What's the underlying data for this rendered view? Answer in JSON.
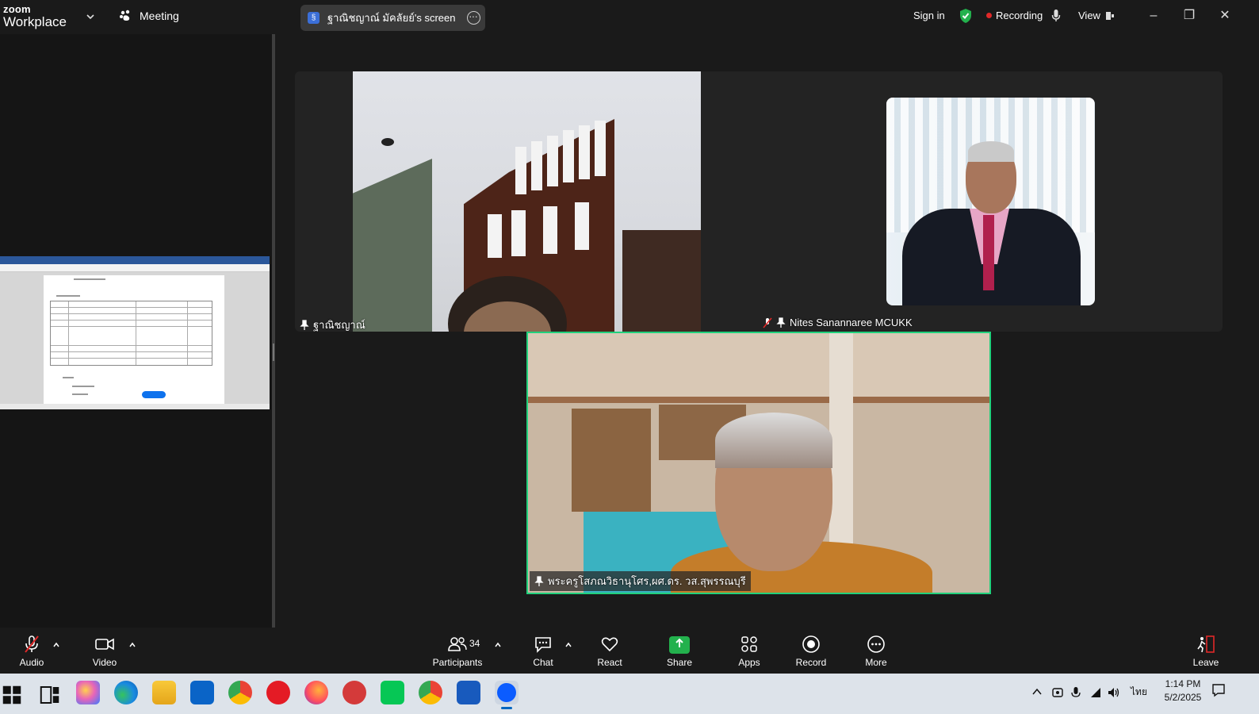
{
  "topbar": {
    "brand_small": "zoom",
    "brand_big": "Workplace",
    "meeting_label": "Meeting",
    "share_screen_label": "ฐาณิชญาณ์ มัคลัยย์'s screen",
    "share_icon_glyph": "§",
    "sign_in": "Sign in",
    "recording": "Recording",
    "view": "View",
    "colors": {
      "shield": "#23b14d",
      "recording_dot": "#e02828"
    }
  },
  "participants_tiles": [
    {
      "name": "ฐาณิชญาณ์"
    },
    {
      "name": "Nites Sanannaree MCUKK",
      "muted": true
    },
    {
      "name": "พระครูโสภณวิธานุโศร,ผศ.ดร. วส.สุพรรณบุรี",
      "active_speaker": true
    }
  ],
  "toolbar": {
    "audio": "Audio",
    "video": "Video",
    "participants": "Participants",
    "participants_count": "34",
    "chat": "Chat",
    "react": "React",
    "share": "Share",
    "apps": "Apps",
    "record": "Record",
    "more": "More",
    "leave": "Leave",
    "colors": {
      "share": "#23b14d",
      "leave": "#e02828",
      "speaker_border": "#21d17c"
    }
  },
  "taskbar": {
    "language": "ไทย",
    "time": "1:14 PM",
    "date": "5/2/2025",
    "apps": [
      "windows-start",
      "task-view",
      "copilot",
      "edge",
      "file-explorer",
      "outlook",
      "chrome",
      "opera",
      "firefox",
      "app-red",
      "line",
      "chrome-profile",
      "word",
      "zoom"
    ]
  }
}
